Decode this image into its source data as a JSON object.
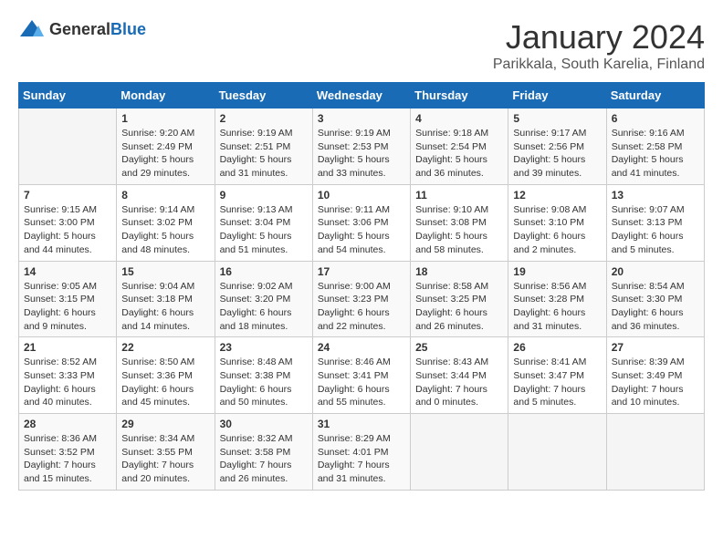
{
  "logo": {
    "text_general": "General",
    "text_blue": "Blue"
  },
  "calendar": {
    "title": "January 2024",
    "subtitle": "Parikkala, South Karelia, Finland"
  },
  "days_of_week": [
    "Sunday",
    "Monday",
    "Tuesday",
    "Wednesday",
    "Thursday",
    "Friday",
    "Saturday"
  ],
  "weeks": [
    [
      {
        "day": "",
        "info": ""
      },
      {
        "day": "1",
        "info": "Sunrise: 9:20 AM\nSunset: 2:49 PM\nDaylight: 5 hours\nand 29 minutes."
      },
      {
        "day": "2",
        "info": "Sunrise: 9:19 AM\nSunset: 2:51 PM\nDaylight: 5 hours\nand 31 minutes."
      },
      {
        "day": "3",
        "info": "Sunrise: 9:19 AM\nSunset: 2:53 PM\nDaylight: 5 hours\nand 33 minutes."
      },
      {
        "day": "4",
        "info": "Sunrise: 9:18 AM\nSunset: 2:54 PM\nDaylight: 5 hours\nand 36 minutes."
      },
      {
        "day": "5",
        "info": "Sunrise: 9:17 AM\nSunset: 2:56 PM\nDaylight: 5 hours\nand 39 minutes."
      },
      {
        "day": "6",
        "info": "Sunrise: 9:16 AM\nSunset: 2:58 PM\nDaylight: 5 hours\nand 41 minutes."
      }
    ],
    [
      {
        "day": "7",
        "info": "Sunrise: 9:15 AM\nSunset: 3:00 PM\nDaylight: 5 hours\nand 44 minutes."
      },
      {
        "day": "8",
        "info": "Sunrise: 9:14 AM\nSunset: 3:02 PM\nDaylight: 5 hours\nand 48 minutes."
      },
      {
        "day": "9",
        "info": "Sunrise: 9:13 AM\nSunset: 3:04 PM\nDaylight: 5 hours\nand 51 minutes."
      },
      {
        "day": "10",
        "info": "Sunrise: 9:11 AM\nSunset: 3:06 PM\nDaylight: 5 hours\nand 54 minutes."
      },
      {
        "day": "11",
        "info": "Sunrise: 9:10 AM\nSunset: 3:08 PM\nDaylight: 5 hours\nand 58 minutes."
      },
      {
        "day": "12",
        "info": "Sunrise: 9:08 AM\nSunset: 3:10 PM\nDaylight: 6 hours\nand 2 minutes."
      },
      {
        "day": "13",
        "info": "Sunrise: 9:07 AM\nSunset: 3:13 PM\nDaylight: 6 hours\nand 5 minutes."
      }
    ],
    [
      {
        "day": "14",
        "info": "Sunrise: 9:05 AM\nSunset: 3:15 PM\nDaylight: 6 hours\nand 9 minutes."
      },
      {
        "day": "15",
        "info": "Sunrise: 9:04 AM\nSunset: 3:18 PM\nDaylight: 6 hours\nand 14 minutes."
      },
      {
        "day": "16",
        "info": "Sunrise: 9:02 AM\nSunset: 3:20 PM\nDaylight: 6 hours\nand 18 minutes."
      },
      {
        "day": "17",
        "info": "Sunrise: 9:00 AM\nSunset: 3:23 PM\nDaylight: 6 hours\nand 22 minutes."
      },
      {
        "day": "18",
        "info": "Sunrise: 8:58 AM\nSunset: 3:25 PM\nDaylight: 6 hours\nand 26 minutes."
      },
      {
        "day": "19",
        "info": "Sunrise: 8:56 AM\nSunset: 3:28 PM\nDaylight: 6 hours\nand 31 minutes."
      },
      {
        "day": "20",
        "info": "Sunrise: 8:54 AM\nSunset: 3:30 PM\nDaylight: 6 hours\nand 36 minutes."
      }
    ],
    [
      {
        "day": "21",
        "info": "Sunrise: 8:52 AM\nSunset: 3:33 PM\nDaylight: 6 hours\nand 40 minutes."
      },
      {
        "day": "22",
        "info": "Sunrise: 8:50 AM\nSunset: 3:36 PM\nDaylight: 6 hours\nand 45 minutes."
      },
      {
        "day": "23",
        "info": "Sunrise: 8:48 AM\nSunset: 3:38 PM\nDaylight: 6 hours\nand 50 minutes."
      },
      {
        "day": "24",
        "info": "Sunrise: 8:46 AM\nSunset: 3:41 PM\nDaylight: 6 hours\nand 55 minutes."
      },
      {
        "day": "25",
        "info": "Sunrise: 8:43 AM\nSunset: 3:44 PM\nDaylight: 7 hours\nand 0 minutes."
      },
      {
        "day": "26",
        "info": "Sunrise: 8:41 AM\nSunset: 3:47 PM\nDaylight: 7 hours\nand 5 minutes."
      },
      {
        "day": "27",
        "info": "Sunrise: 8:39 AM\nSunset: 3:49 PM\nDaylight: 7 hours\nand 10 minutes."
      }
    ],
    [
      {
        "day": "28",
        "info": "Sunrise: 8:36 AM\nSunset: 3:52 PM\nDaylight: 7 hours\nand 15 minutes."
      },
      {
        "day": "29",
        "info": "Sunrise: 8:34 AM\nSunset: 3:55 PM\nDaylight: 7 hours\nand 20 minutes."
      },
      {
        "day": "30",
        "info": "Sunrise: 8:32 AM\nSunset: 3:58 PM\nDaylight: 7 hours\nand 26 minutes."
      },
      {
        "day": "31",
        "info": "Sunrise: 8:29 AM\nSunset: 4:01 PM\nDaylight: 7 hours\nand 31 minutes."
      },
      {
        "day": "",
        "info": ""
      },
      {
        "day": "",
        "info": ""
      },
      {
        "day": "",
        "info": ""
      }
    ]
  ]
}
